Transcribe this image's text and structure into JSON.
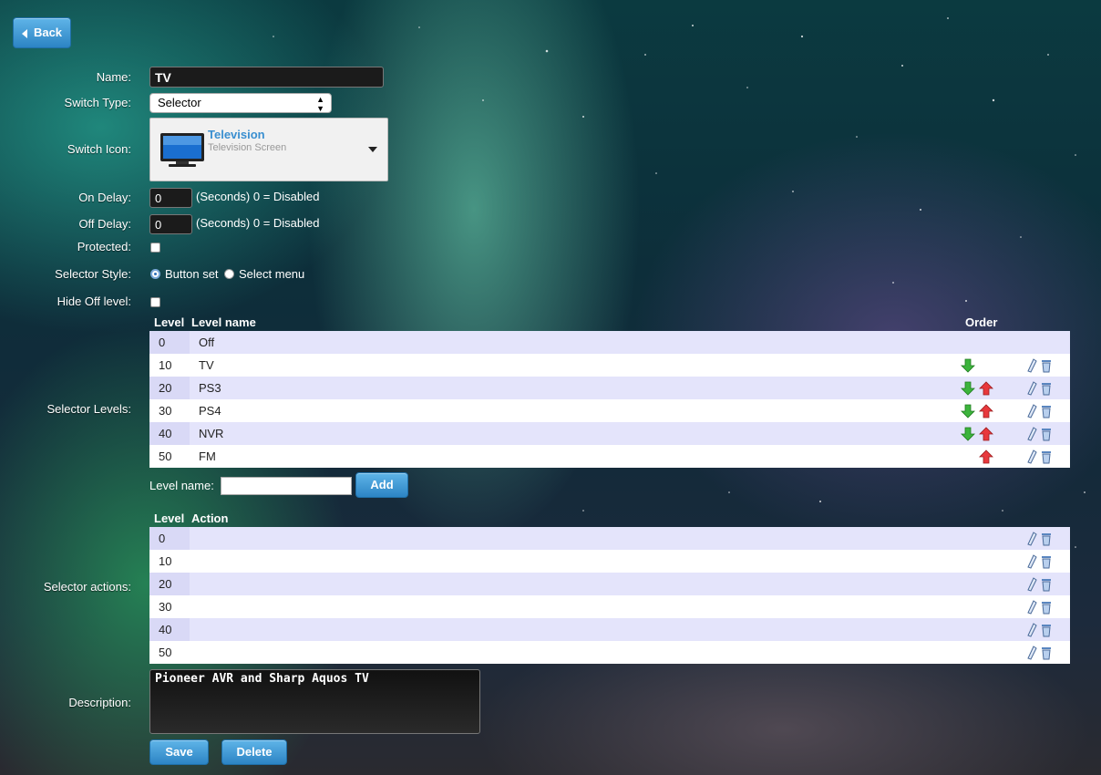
{
  "back_label": "Back",
  "form": {
    "name_label": "Name:",
    "name_value": "TV",
    "switch_type_label": "Switch Type:",
    "switch_type_value": "Selector",
    "switch_icon_label": "Switch Icon:",
    "icon_title": "Television",
    "icon_subtitle": "Television Screen",
    "on_delay_label": "On Delay:",
    "on_delay_value": "0",
    "on_delay_hint": "(Seconds) 0 = Disabled",
    "off_delay_label": "Off Delay:",
    "off_delay_value": "0",
    "off_delay_hint": "(Seconds) 0 = Disabled",
    "protected_label": "Protected:",
    "selector_style_label": "Selector Style:",
    "style_option_1": "Button set",
    "style_option_2": "Select menu",
    "hide_off_label": "Hide Off level:"
  },
  "levels": {
    "section_label": "Selector Levels:",
    "col_level": "Level",
    "col_name": "Level name",
    "col_order": "Order",
    "rows": [
      {
        "level": "0",
        "name": "Off"
      },
      {
        "level": "10",
        "name": "TV"
      },
      {
        "level": "20",
        "name": "PS3"
      },
      {
        "level": "30",
        "name": "PS4"
      },
      {
        "level": "40",
        "name": "NVR"
      },
      {
        "level": "50",
        "name": "FM"
      }
    ],
    "add_label": "Level name:",
    "add_button": "Add"
  },
  "actions": {
    "section_label": "Selector actions:",
    "col_level": "Level",
    "col_action": "Action",
    "rows": [
      {
        "level": "0",
        "action": ""
      },
      {
        "level": "10",
        "action": ""
      },
      {
        "level": "20",
        "action": ""
      },
      {
        "level": "30",
        "action": ""
      },
      {
        "level": "40",
        "action": ""
      },
      {
        "level": "50",
        "action": ""
      }
    ]
  },
  "description": {
    "label": "Description:",
    "value": "Pioneer AVR and Sharp Aquos TV"
  },
  "buttons": {
    "save": "Save",
    "delete": "Delete"
  },
  "colors": {
    "button_blue": "#2c84c4",
    "icon_title_blue": "#3a8fd0",
    "arrow_down_green": "#3cb43c",
    "arrow_up_red": "#e8383c",
    "row_odd": "#e4e4fb"
  }
}
